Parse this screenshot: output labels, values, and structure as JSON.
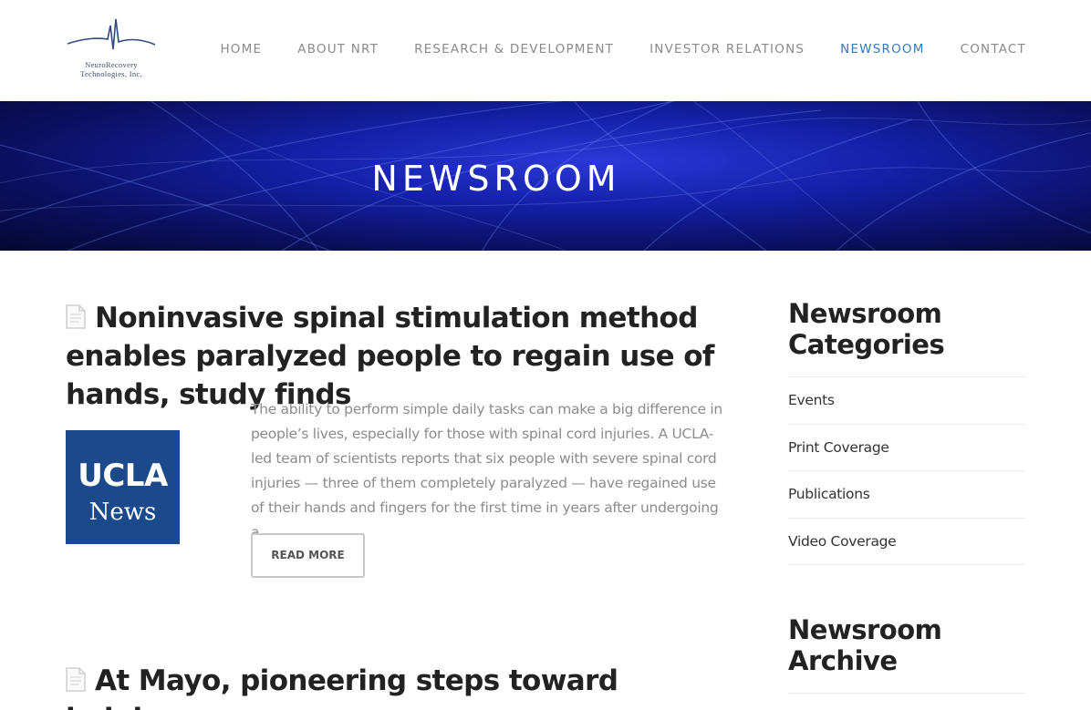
{
  "brand": {
    "logo_line1": "NeuroRecovery",
    "logo_line2": "Technologies, Inc.",
    "logo_icon": "heartbeat-line-icon"
  },
  "nav": {
    "items": [
      {
        "label": "HOME",
        "active": false
      },
      {
        "label": "ABOUT NRT",
        "active": false
      },
      {
        "label": "RESEARCH & DEVELOPMENT",
        "active": false
      },
      {
        "label": "INVESTOR RELATIONS",
        "active": false
      },
      {
        "label": "NEWSROOM",
        "active": true
      },
      {
        "label": "CONTACT",
        "active": false
      }
    ],
    "active_color": "#3a78b5"
  },
  "hero": {
    "title": "NEWSROOM"
  },
  "posts": [
    {
      "title": "Noninvasive spinal stimulation method enables paralyzed people to regain use of hands, study finds",
      "icon": "document-icon",
      "thumbnail": {
        "line1": "UCLA",
        "line2": "News",
        "color": "#1a4a8c"
      },
      "excerpt": "The ability to perform simple daily tasks can make a big difference in people’s lives, especially for those with spinal cord injuries. A UCLA-led team of scientists reports that six people with severe spinal cord injuries — three of them completely paralyzed — have regained use of their hands and fingers for the first time in years after undergoing a …",
      "read_more": "READ MORE"
    },
    {
      "title": "At Mayo, pioneering steps toward helping",
      "icon": "document-icon"
    }
  ],
  "sidebar": {
    "categories_title_line1": "Newsroom",
    "categories_title_line2": "Categories",
    "categories": [
      "Events",
      "Print Coverage",
      "Publications",
      "Video Coverage"
    ],
    "archive_title_line1": "Newsroom",
    "archive_title_line2": "Archive"
  }
}
